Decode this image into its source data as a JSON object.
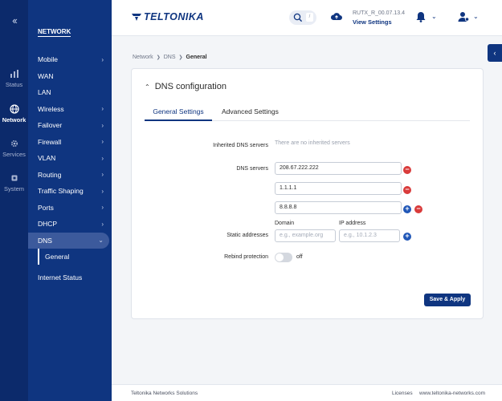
{
  "rail": {
    "items": [
      {
        "label": "Status",
        "icon": "status-icon"
      },
      {
        "label": "Network",
        "icon": "globe-icon"
      },
      {
        "label": "Services",
        "icon": "gear-icon"
      },
      {
        "label": "System",
        "icon": "chip-icon"
      }
    ],
    "collapse_glyph": "<<"
  },
  "nav": {
    "title": "NETWORK",
    "items": [
      {
        "label": "Mobile",
        "chevron": ">"
      },
      {
        "label": "WAN",
        "chevron": ""
      },
      {
        "label": "LAN",
        "chevron": ""
      },
      {
        "label": "Wireless",
        "chevron": ">"
      },
      {
        "label": "Failover",
        "chevron": ">"
      },
      {
        "label": "Firewall",
        "chevron": ">"
      },
      {
        "label": "VLAN",
        "chevron": ">"
      },
      {
        "label": "Routing",
        "chevron": ">"
      },
      {
        "label": "Traffic Shaping",
        "chevron": ">"
      },
      {
        "label": "Ports",
        "chevron": ">"
      },
      {
        "label": "DHCP",
        "chevron": ">"
      },
      {
        "label": "DNS",
        "chevron": "v"
      }
    ],
    "sub_item": "General",
    "extra_item": "Internet Status"
  },
  "topbar": {
    "logo": "TELTONIKA",
    "search_hint": "/",
    "firmware": "RUTX_R_00.07.13.4",
    "view_settings": "View Settings"
  },
  "breadcrumb": [
    "Network",
    "DNS",
    "General"
  ],
  "card": {
    "title": "DNS configuration",
    "tabs": [
      "General Settings",
      "Advanced Settings"
    ],
    "inherited_label": "Inherited DNS servers",
    "inherited_value": "There are no inherited servers",
    "dns_label": "DNS servers",
    "dns_servers": [
      "208.67.222.222",
      "1.1.1.1",
      "8.8.8.8"
    ],
    "static_label": "Static addresses",
    "domain_header": "Domain",
    "ip_header": "IP address",
    "domain_placeholder": "e.g., example.org",
    "ip_placeholder": "e.g., 10.1.2.3",
    "rebind_label": "Rebind protection",
    "rebind_state": "off",
    "save_label": "Save & Apply"
  },
  "footer": {
    "company": "Teltonika Networks Solutions",
    "licenses": "Licenses",
    "site": "www.teltonika-networks.com"
  },
  "colors": {
    "primary": "#0f3580",
    "rail": "#0c2a6b",
    "danger": "#d93b3b",
    "add": "#2157b7"
  }
}
